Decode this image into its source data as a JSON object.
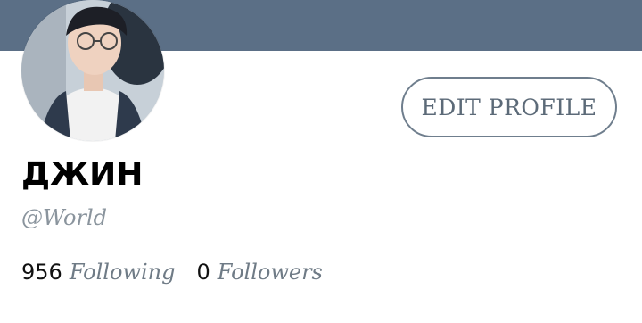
{
  "profile": {
    "display_name": "ДЖИН",
    "handle": "@World",
    "edit_button_label": "EDIT PROFILE"
  },
  "stats": {
    "following_count": "956",
    "following_label": "Following",
    "followers_count": "0",
    "followers_label": "Followers"
  },
  "colors": {
    "banner": "#5b6f86",
    "button_border": "#6f7e8d",
    "muted_text": "#8a949d"
  }
}
